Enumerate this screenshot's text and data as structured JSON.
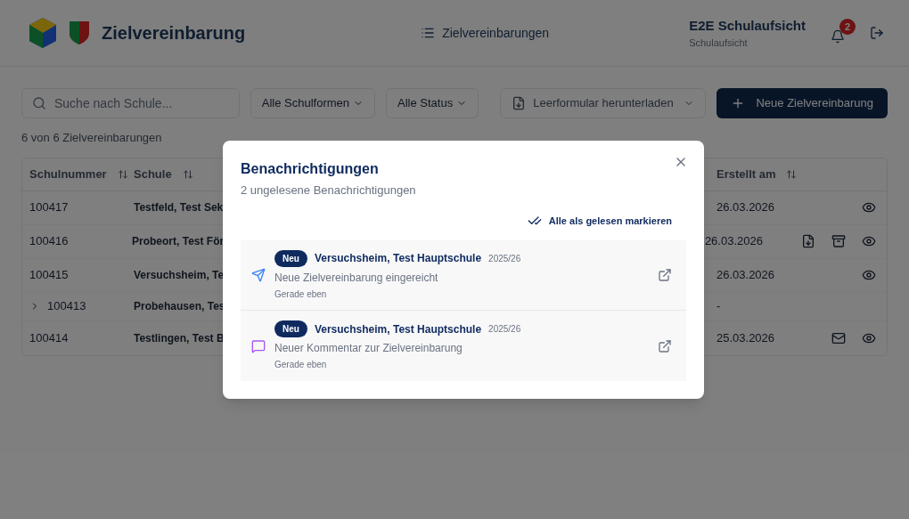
{
  "header": {
    "app_title": "Zielvereinbarung",
    "nav_link": "Zielvereinbarungen",
    "user_name": "E2E Schulaufsicht",
    "user_role": "Schulaufsicht",
    "notification_count": "2"
  },
  "toolbar": {
    "search": {
      "placeholder": "Suche nach Schule..."
    },
    "filters": [
      "Alle Schulformen",
      "Alle Status"
    ],
    "download": "Leerformular herunterladen",
    "new_button": "Neue Zielvereinbarung"
  },
  "count": "6 von 6 Zielvereinbarungen",
  "table": {
    "columns": [
      "Schulnummer",
      "Schule",
      "Erstellt am"
    ],
    "rows": [
      {
        "number": "100417",
        "school": "Testfeld, Test Sek",
        "date": "26.03.2026",
        "expandable": false,
        "can_download": false,
        "can_archive": false,
        "can_mail": false,
        "can_view": true
      },
      {
        "number": "100416",
        "school": "Probeort, Test För",
        "date": "26.03.2026",
        "expandable": false,
        "can_download": true,
        "can_archive": true,
        "can_mail": false,
        "can_view": true
      },
      {
        "number": "100415",
        "school": "Versuchsheim, Te",
        "date": "26.03.2026",
        "expandable": false,
        "can_download": false,
        "can_archive": false,
        "can_mail": false,
        "can_view": true
      },
      {
        "number": "100413",
        "school": "Probehausen, Tes",
        "date": "-",
        "expandable": true,
        "expanded": false,
        "can_download": false,
        "can_archive": false,
        "can_mail": false,
        "can_view": false
      },
      {
        "number": "100414",
        "school": "Testlingen, Test B",
        "date": "25.03.2026",
        "expandable": false,
        "can_download": false,
        "can_archive": false,
        "can_mail": true,
        "can_view": true
      }
    ]
  },
  "dialog": {
    "title": "Benachrichtigungen",
    "subtitle": "2 ungelesene Benachrichtigungen",
    "mark_all": "Alle als gelesen markieren",
    "items": [
      {
        "kind": "submitted",
        "badge": "Neu",
        "school": "Versuchsheim, Test Hauptschule",
        "year": "2025/26",
        "message": "Neue Zielvereinbarung eingereicht",
        "time": "Gerade eben",
        "color": "#3b82f6"
      },
      {
        "kind": "comment",
        "badge": "Neu",
        "school": "Versuchsheim, Test Hauptschule",
        "year": "2025/26",
        "message": "Neuer Kommentar zur Zielvereinbarung",
        "time": "Gerade eben",
        "color": "#a855f7"
      }
    ]
  }
}
